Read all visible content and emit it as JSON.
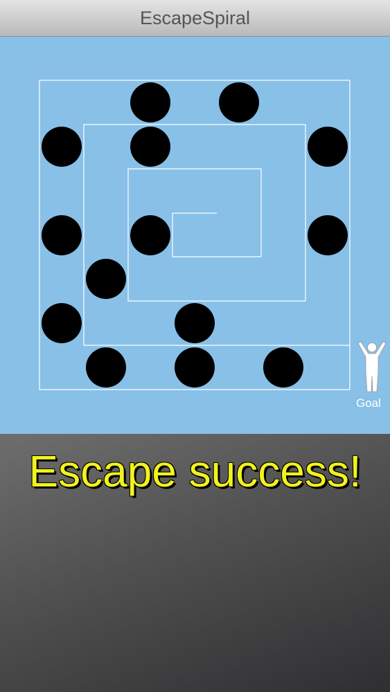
{
  "app": {
    "title": "EscapeSpiral"
  },
  "board": {
    "background_color": "#88c0e8",
    "wall_color": "#ffffff",
    "piece_color": "#000000",
    "goal_label": "Goal",
    "goal_icon": "person-arms-raised-icon"
  },
  "status": {
    "message": "Escape success!",
    "message_color": "#f2f21e"
  }
}
